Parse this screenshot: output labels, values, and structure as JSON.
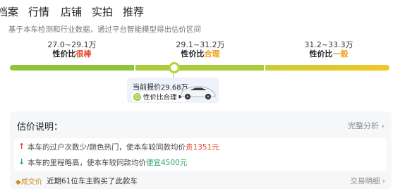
{
  "tabs": [
    {
      "label": "档案"
    },
    {
      "label": "行情"
    },
    {
      "label": "店铺"
    },
    {
      "label": "实拍"
    },
    {
      "label": "推荐"
    }
  ],
  "subtitle": "基于本车检测和行业数据，通过平台智能模型得出估价区间",
  "ranges": [
    {
      "range": "27.0~29.1万",
      "prefix": "性价比",
      "tag": "很棒",
      "color": "#e64a2e"
    },
    {
      "range": "29.1~31.2万",
      "prefix": "性价比",
      "tag": "合理",
      "color": "#f0a020"
    },
    {
      "range": "31.2~33.3万",
      "prefix": "性价比",
      "tag": "一般",
      "color": "#f0a020"
    }
  ],
  "current": {
    "label": "当前报价29.68万",
    "position_fraction": 0.11,
    "pill": "性价比合理"
  },
  "estimate": {
    "title": "估价说明：",
    "link": "完整分析 ›",
    "items": [
      {
        "arrow": "↑",
        "arrow_color": "#e64a2e",
        "prefix": "本车的过户次数少/颜色热门，使本车较同款均价",
        "highlight": "贵1351元",
        "highlight_color": "#e64a2e"
      },
      {
        "arrow": "↓",
        "arrow_color": "#2aa46a",
        "prefix": "本车的里程略高，使本车较同款均价",
        "highlight": "便宜4500元",
        "highlight_color": "#2aa46a"
      }
    ],
    "bottom": {
      "badge": "◆成交价",
      "text": "近期61位车主购买了此款车",
      "link": "交易明细 ›"
    }
  }
}
